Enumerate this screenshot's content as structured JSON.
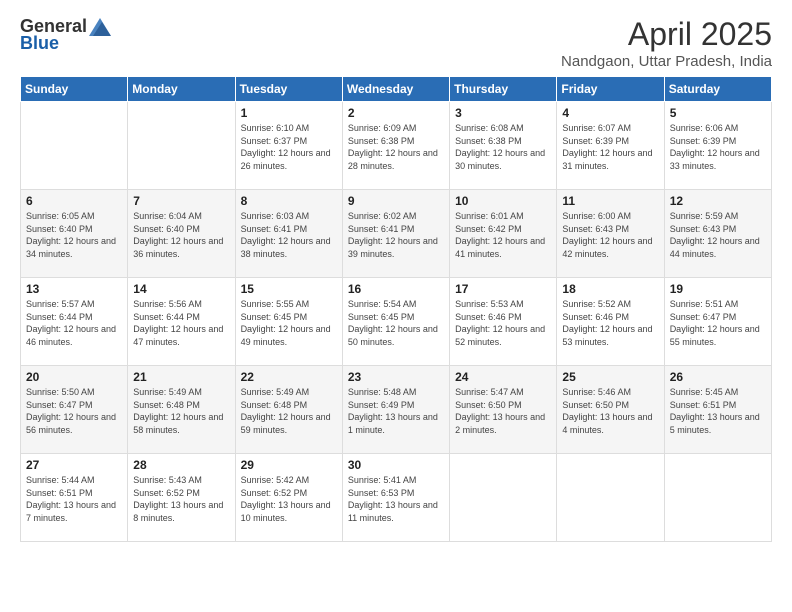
{
  "logo": {
    "general": "General",
    "blue": "Blue"
  },
  "header": {
    "title": "April 2025",
    "subtitle": "Nandgaon, Uttar Pradesh, India"
  },
  "weekdays": [
    "Sunday",
    "Monday",
    "Tuesday",
    "Wednesday",
    "Thursday",
    "Friday",
    "Saturday"
  ],
  "weeks": [
    [
      {
        "day": "",
        "sunrise": "",
        "sunset": "",
        "daylight": ""
      },
      {
        "day": "",
        "sunrise": "",
        "sunset": "",
        "daylight": ""
      },
      {
        "day": "1",
        "sunrise": "Sunrise: 6:10 AM",
        "sunset": "Sunset: 6:37 PM",
        "daylight": "Daylight: 12 hours and 26 minutes."
      },
      {
        "day": "2",
        "sunrise": "Sunrise: 6:09 AM",
        "sunset": "Sunset: 6:38 PM",
        "daylight": "Daylight: 12 hours and 28 minutes."
      },
      {
        "day": "3",
        "sunrise": "Sunrise: 6:08 AM",
        "sunset": "Sunset: 6:38 PM",
        "daylight": "Daylight: 12 hours and 30 minutes."
      },
      {
        "day": "4",
        "sunrise": "Sunrise: 6:07 AM",
        "sunset": "Sunset: 6:39 PM",
        "daylight": "Daylight: 12 hours and 31 minutes."
      },
      {
        "day": "5",
        "sunrise": "Sunrise: 6:06 AM",
        "sunset": "Sunset: 6:39 PM",
        "daylight": "Daylight: 12 hours and 33 minutes."
      }
    ],
    [
      {
        "day": "6",
        "sunrise": "Sunrise: 6:05 AM",
        "sunset": "Sunset: 6:40 PM",
        "daylight": "Daylight: 12 hours and 34 minutes."
      },
      {
        "day": "7",
        "sunrise": "Sunrise: 6:04 AM",
        "sunset": "Sunset: 6:40 PM",
        "daylight": "Daylight: 12 hours and 36 minutes."
      },
      {
        "day": "8",
        "sunrise": "Sunrise: 6:03 AM",
        "sunset": "Sunset: 6:41 PM",
        "daylight": "Daylight: 12 hours and 38 minutes."
      },
      {
        "day": "9",
        "sunrise": "Sunrise: 6:02 AM",
        "sunset": "Sunset: 6:41 PM",
        "daylight": "Daylight: 12 hours and 39 minutes."
      },
      {
        "day": "10",
        "sunrise": "Sunrise: 6:01 AM",
        "sunset": "Sunset: 6:42 PM",
        "daylight": "Daylight: 12 hours and 41 minutes."
      },
      {
        "day": "11",
        "sunrise": "Sunrise: 6:00 AM",
        "sunset": "Sunset: 6:43 PM",
        "daylight": "Daylight: 12 hours and 42 minutes."
      },
      {
        "day": "12",
        "sunrise": "Sunrise: 5:59 AM",
        "sunset": "Sunset: 6:43 PM",
        "daylight": "Daylight: 12 hours and 44 minutes."
      }
    ],
    [
      {
        "day": "13",
        "sunrise": "Sunrise: 5:57 AM",
        "sunset": "Sunset: 6:44 PM",
        "daylight": "Daylight: 12 hours and 46 minutes."
      },
      {
        "day": "14",
        "sunrise": "Sunrise: 5:56 AM",
        "sunset": "Sunset: 6:44 PM",
        "daylight": "Daylight: 12 hours and 47 minutes."
      },
      {
        "day": "15",
        "sunrise": "Sunrise: 5:55 AM",
        "sunset": "Sunset: 6:45 PM",
        "daylight": "Daylight: 12 hours and 49 minutes."
      },
      {
        "day": "16",
        "sunrise": "Sunrise: 5:54 AM",
        "sunset": "Sunset: 6:45 PM",
        "daylight": "Daylight: 12 hours and 50 minutes."
      },
      {
        "day": "17",
        "sunrise": "Sunrise: 5:53 AM",
        "sunset": "Sunset: 6:46 PM",
        "daylight": "Daylight: 12 hours and 52 minutes."
      },
      {
        "day": "18",
        "sunrise": "Sunrise: 5:52 AM",
        "sunset": "Sunset: 6:46 PM",
        "daylight": "Daylight: 12 hours and 53 minutes."
      },
      {
        "day": "19",
        "sunrise": "Sunrise: 5:51 AM",
        "sunset": "Sunset: 6:47 PM",
        "daylight": "Daylight: 12 hours and 55 minutes."
      }
    ],
    [
      {
        "day": "20",
        "sunrise": "Sunrise: 5:50 AM",
        "sunset": "Sunset: 6:47 PM",
        "daylight": "Daylight: 12 hours and 56 minutes."
      },
      {
        "day": "21",
        "sunrise": "Sunrise: 5:49 AM",
        "sunset": "Sunset: 6:48 PM",
        "daylight": "Daylight: 12 hours and 58 minutes."
      },
      {
        "day": "22",
        "sunrise": "Sunrise: 5:49 AM",
        "sunset": "Sunset: 6:48 PM",
        "daylight": "Daylight: 12 hours and 59 minutes."
      },
      {
        "day": "23",
        "sunrise": "Sunrise: 5:48 AM",
        "sunset": "Sunset: 6:49 PM",
        "daylight": "Daylight: 13 hours and 1 minute."
      },
      {
        "day": "24",
        "sunrise": "Sunrise: 5:47 AM",
        "sunset": "Sunset: 6:50 PM",
        "daylight": "Daylight: 13 hours and 2 minutes."
      },
      {
        "day": "25",
        "sunrise": "Sunrise: 5:46 AM",
        "sunset": "Sunset: 6:50 PM",
        "daylight": "Daylight: 13 hours and 4 minutes."
      },
      {
        "day": "26",
        "sunrise": "Sunrise: 5:45 AM",
        "sunset": "Sunset: 6:51 PM",
        "daylight": "Daylight: 13 hours and 5 minutes."
      }
    ],
    [
      {
        "day": "27",
        "sunrise": "Sunrise: 5:44 AM",
        "sunset": "Sunset: 6:51 PM",
        "daylight": "Daylight: 13 hours and 7 minutes."
      },
      {
        "day": "28",
        "sunrise": "Sunrise: 5:43 AM",
        "sunset": "Sunset: 6:52 PM",
        "daylight": "Daylight: 13 hours and 8 minutes."
      },
      {
        "day": "29",
        "sunrise": "Sunrise: 5:42 AM",
        "sunset": "Sunset: 6:52 PM",
        "daylight": "Daylight: 13 hours and 10 minutes."
      },
      {
        "day": "30",
        "sunrise": "Sunrise: 5:41 AM",
        "sunset": "Sunset: 6:53 PM",
        "daylight": "Daylight: 13 hours and 11 minutes."
      },
      {
        "day": "",
        "sunrise": "",
        "sunset": "",
        "daylight": ""
      },
      {
        "day": "",
        "sunrise": "",
        "sunset": "",
        "daylight": ""
      },
      {
        "day": "",
        "sunrise": "",
        "sunset": "",
        "daylight": ""
      }
    ]
  ]
}
